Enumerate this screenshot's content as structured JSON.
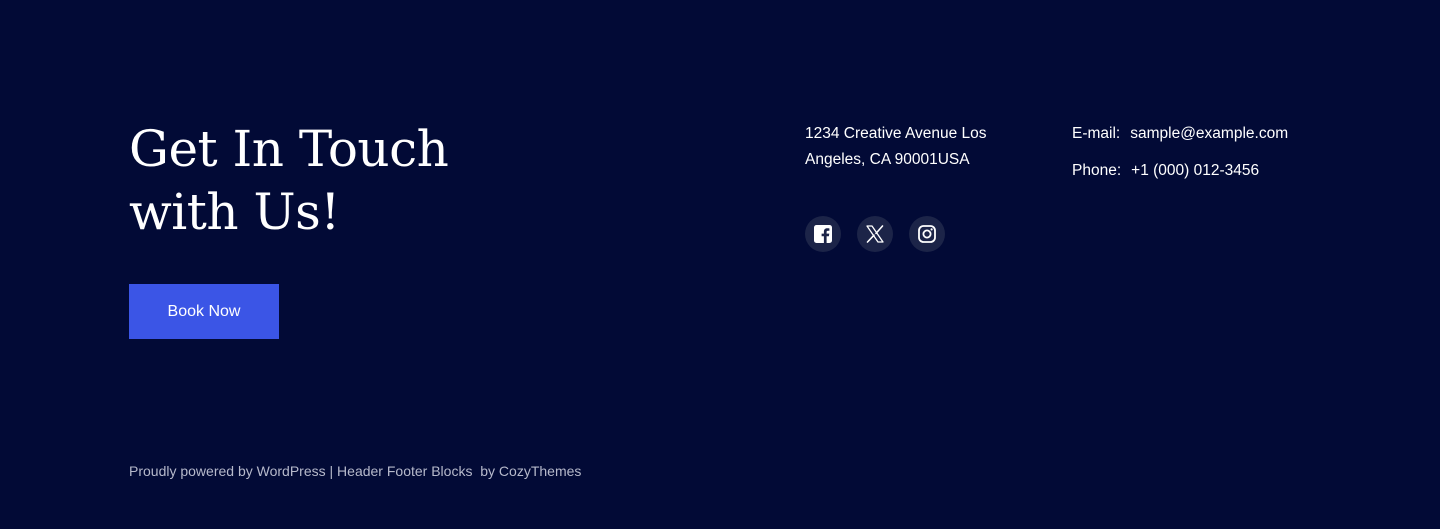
{
  "cta": {
    "heading_line1": "Get In Touch",
    "heading_line2": "with Us!",
    "button_label": "Book Now"
  },
  "address": {
    "line1": "1234 Creative Avenue Los",
    "line2": "Angeles, CA 90001USA"
  },
  "contact": {
    "email_label": "E-mail:",
    "email_value": "sample@example.com",
    "phone_label": "Phone:",
    "phone_value": "+1 (000) 012-3456"
  },
  "socials": [
    {
      "icon": "facebook-icon"
    },
    {
      "icon": "x-twitter-icon"
    },
    {
      "icon": "instagram-icon"
    }
  ],
  "credits": {
    "prefix": "Proudly powered by ",
    "wordpress": "WordPress",
    "separator": " | ",
    "plugin": "Header Footer Blocks",
    "by": "  by ",
    "author": "CozyThemes"
  },
  "colors": {
    "background": "#020a36",
    "button": "#3b55e6",
    "social_bg": "#1c2448",
    "credits_text": "#b6b9cb"
  }
}
